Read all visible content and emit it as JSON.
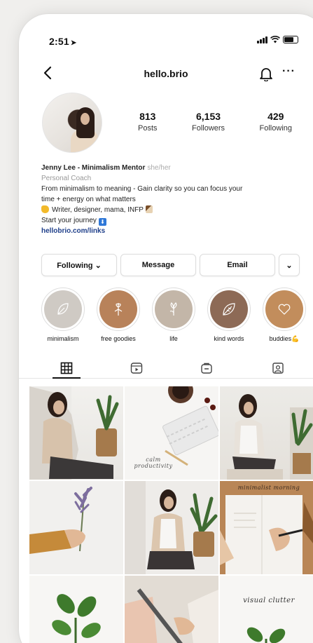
{
  "status": {
    "time": "2:51"
  },
  "nav": {
    "handle": "hello.brio"
  },
  "profile": {
    "stats": [
      {
        "value": "813",
        "label": "Posts"
      },
      {
        "value": "6,153",
        "label": "Followers"
      },
      {
        "value": "429",
        "label": "Following"
      }
    ],
    "name": "Jenny Lee - Minimalism Mentor",
    "pronouns": "she/her",
    "category": "Personal Coach",
    "bio_line1": "From minimalism to meaning - Gain clarity so you can focus your",
    "bio_line2": "time + energy on what matters",
    "bio_line3": "Writer, designer, mama, INFP",
    "bio_line4": "Start your journey",
    "link": "hellobrio.com/links"
  },
  "buttons": {
    "following": "Following ⌄",
    "message": "Message",
    "email": "Email",
    "more": "⌄"
  },
  "highlights": [
    {
      "label": "minimalism",
      "color": "#cfcac4",
      "icon": "leaf-icon"
    },
    {
      "label": "free goodies",
      "color": "#b8825a",
      "icon": "gift-icon"
    },
    {
      "label": "life",
      "color": "#c3b6a8",
      "icon": "flower-icon"
    },
    {
      "label": "kind words",
      "color": "#8d6a56",
      "icon": "leaf-icon"
    },
    {
      "label": "buddies💪",
      "color": "#c28d5c",
      "icon": "heart-icon"
    }
  ],
  "tabs": [
    "grid-icon",
    "reels-icon",
    "guides-icon",
    "tagged-icon"
  ],
  "captions": {
    "post2": "calm productivity",
    "post6": "minimalist morning",
    "post9": "visual clutter"
  },
  "colors": {
    "link": "#1f3f8a",
    "accent": "#111111"
  }
}
